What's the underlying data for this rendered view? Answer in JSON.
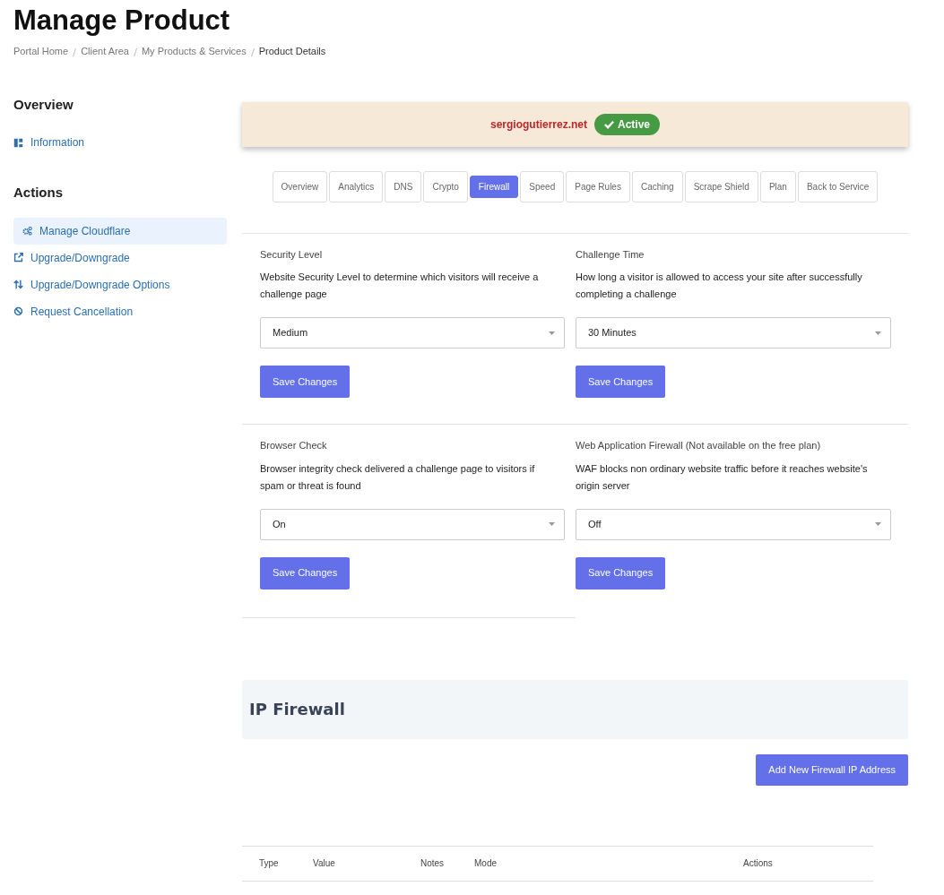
{
  "page_title": "Manage Product",
  "breadcrumb": [
    "Portal Home",
    "Client Area",
    "My Products & Services",
    "Product Details"
  ],
  "sidebar": [
    {
      "heading": "Overview",
      "items": [
        {
          "label": "Information",
          "selected": false
        }
      ]
    },
    {
      "heading": "Actions",
      "items": [
        {
          "label": "Manage Cloudflare",
          "selected": true
        },
        {
          "label": "Upgrade/Downgrade",
          "selected": false
        },
        {
          "label": "Upgrade/Downgrade Options",
          "selected": false
        },
        {
          "label": "Request Cancellation",
          "selected": false
        }
      ]
    }
  ],
  "domain": {
    "name": "sergiogutierrez.net",
    "status": "Active"
  },
  "tabs": [
    {
      "label": "Overview",
      "selected": false
    },
    {
      "label": "Analytics",
      "selected": false
    },
    {
      "label": "DNS",
      "selected": false
    },
    {
      "label": "Crypto",
      "selected": false
    },
    {
      "label": "Firewall",
      "selected": true
    },
    {
      "label": "Speed",
      "selected": false
    },
    {
      "label": "Page Rules",
      "selected": false
    },
    {
      "label": "Caching",
      "selected": false
    },
    {
      "label": "Scrape Shield",
      "selected": false
    },
    {
      "label": "Plan",
      "selected": false
    },
    {
      "label": "Back to Service",
      "selected": false
    }
  ],
  "settings": [
    {
      "title": "Security Level",
      "description": "Website Security Level to determine which visitors will receive a challenge page",
      "value": "Medium",
      "button": "Save Changes"
    },
    {
      "title": "Challenge Time",
      "description": "How long a visitor is allowed to access your site after successfully completing a challenge",
      "value": "30 Minutes",
      "button": "Save Changes"
    },
    {
      "title": "Browser Check",
      "description": "Browser integrity check delivered a challenge page to visitors if spam or threat is found",
      "value": "On",
      "button": "Save Changes"
    },
    {
      "title": "Web Application Firewall (Not available on the free plan)",
      "description": "WAF blocks non ordinary website traffic before it reaches website's origin server",
      "value": "Off",
      "button": "Save Changes"
    }
  ],
  "ip_firewall": {
    "title": "IP Firewall",
    "add_button": "Add New Firewall IP Address",
    "columns": [
      "Type",
      "Value",
      "Notes",
      "Mode",
      "Actions"
    ]
  }
}
